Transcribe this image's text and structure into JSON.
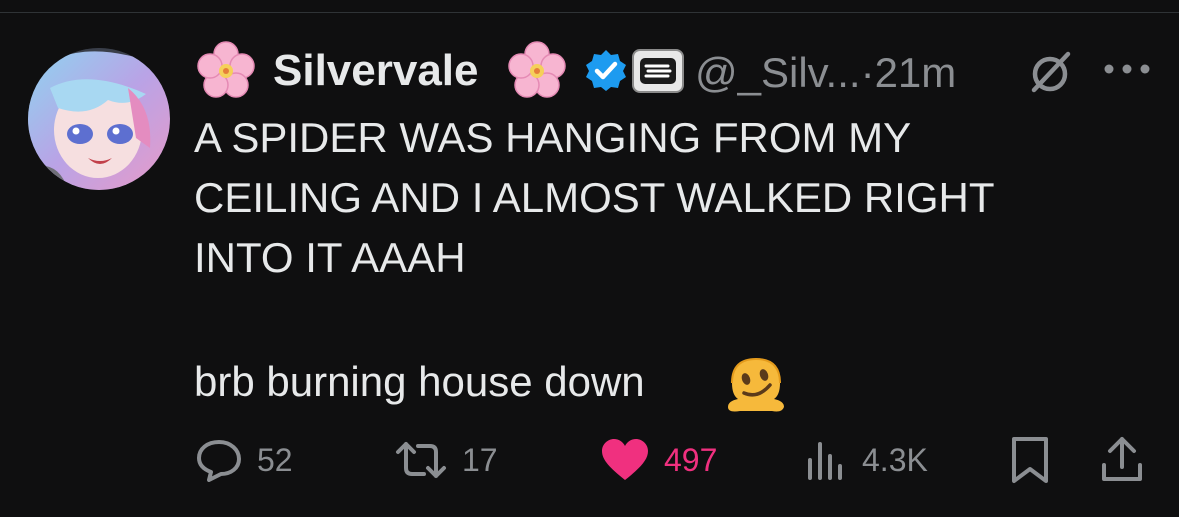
{
  "post": {
    "display_name": "Silvervale",
    "handle": "@_Silv...",
    "separator": "·",
    "time_ago": "21m",
    "text_lines": [
      "A SPIDER WAS HANGING FROM MY",
      "CEILING AND I ALMOST WALKED RIGHT",
      "INTO IT AAAH"
    ],
    "second_paragraph": "brb burning house down",
    "icons": {
      "decoration": "cherry-blossom-icon",
      "verified": "verified-badge-icon",
      "affiliate": "affiliate-badge-icon",
      "grok": "grok-icon",
      "more": "more-icon",
      "emoji": "melting-face-emoji"
    }
  },
  "actions": {
    "replies": "52",
    "reposts": "17",
    "likes": "497",
    "views": "4.3K"
  },
  "colors": {
    "background": "#0f0f10",
    "text": "#e7e9ea",
    "muted": "#8b8e92",
    "verified": "#1d9bf0",
    "like": "#f0307f"
  }
}
